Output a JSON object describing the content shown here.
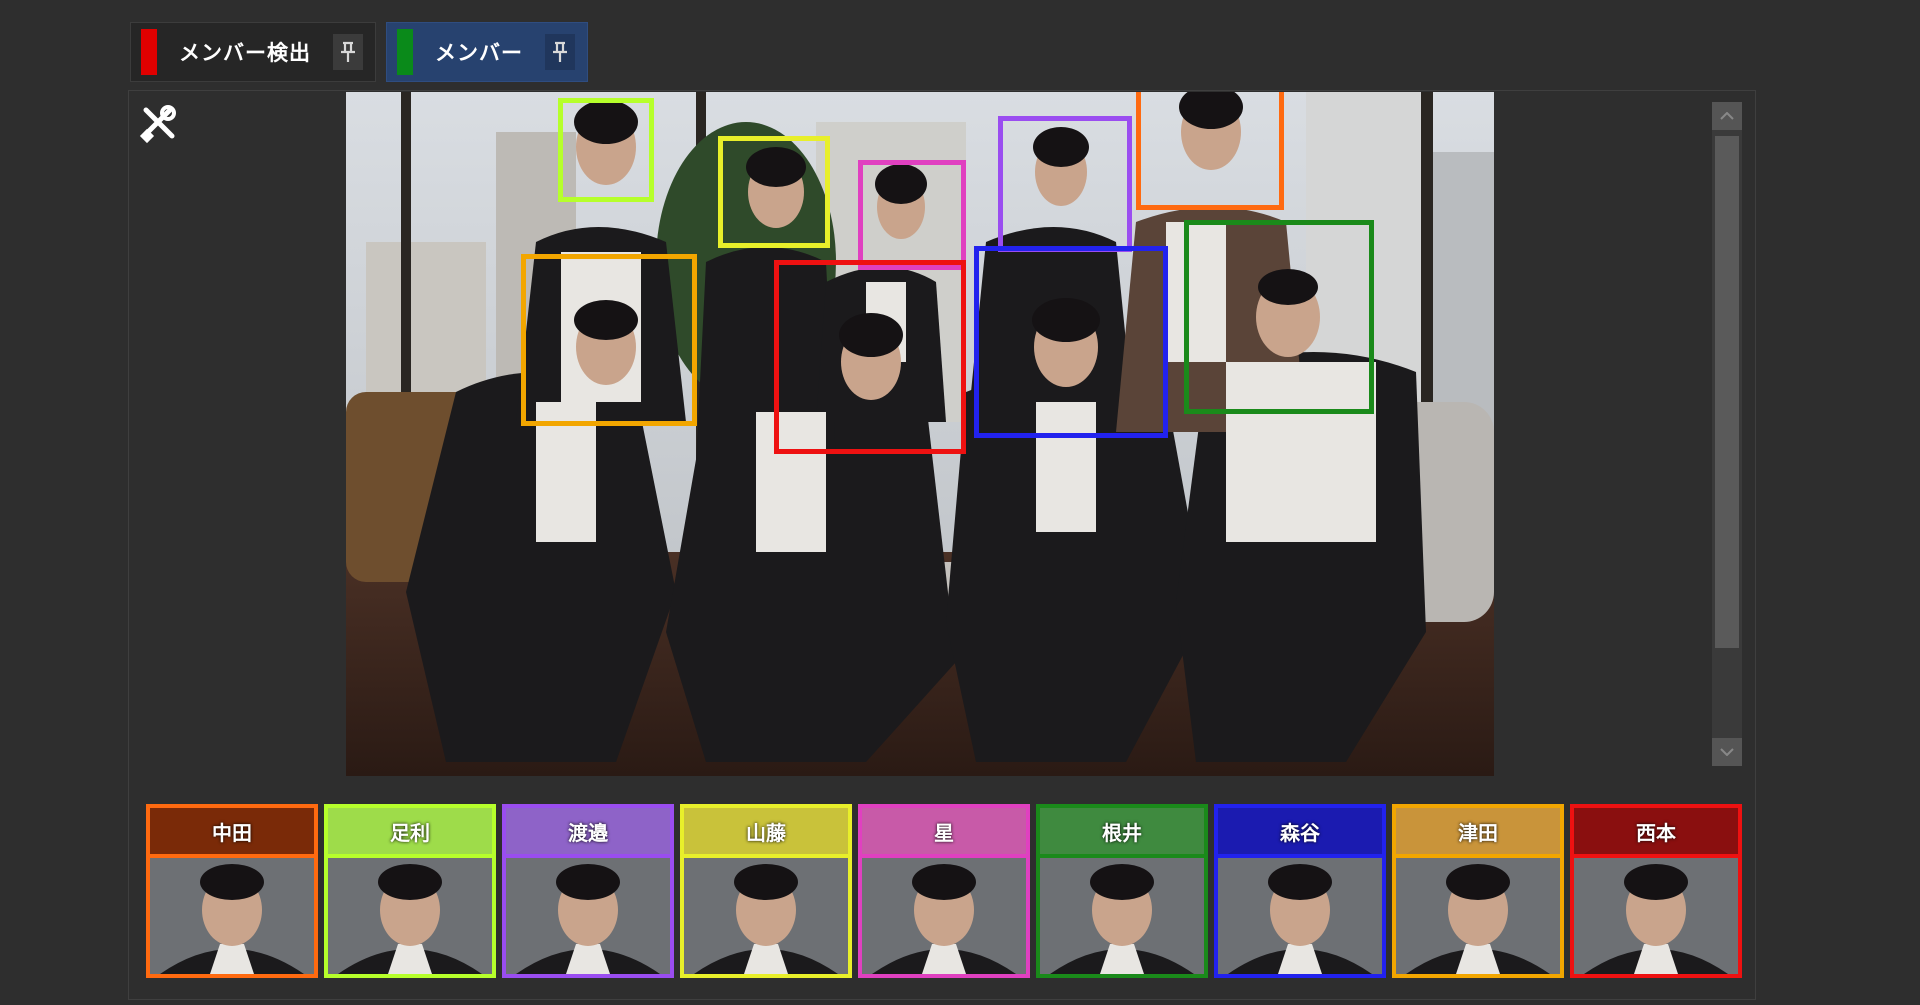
{
  "tabs": [
    {
      "label": "メンバー検出",
      "swatch": "#e00000",
      "active": false
    },
    {
      "label": "メンバー",
      "swatch": "#0a8a1a",
      "active": true
    }
  ],
  "tools": {
    "icon": "tools-icon"
  },
  "detections": [
    {
      "color": "#b6ff2b",
      "member": "足利"
    },
    {
      "color": "#e8ef2a",
      "member": "山藤"
    },
    {
      "color": "#e040c0",
      "member": "星"
    },
    {
      "color": "#9a4df0",
      "member": "渡邉"
    },
    {
      "color": "#ff6a10",
      "member": "中田"
    },
    {
      "color": "#f2a600",
      "member": "津田"
    },
    {
      "color": "#ee1111",
      "member": "西本"
    },
    {
      "color": "#2222ee",
      "member": "森谷"
    },
    {
      "color": "#1a8a1a",
      "member": "根井"
    }
  ],
  "members": [
    {
      "name": "中田",
      "color": "#ff6a10",
      "head": "#7a2a08"
    },
    {
      "name": "足利",
      "color": "#b6ff2b",
      "head": "#9edc4a"
    },
    {
      "name": "渡邉",
      "color": "#9a4df0",
      "head": "#8e63c8"
    },
    {
      "name": "山藤",
      "color": "#e8ef2a",
      "head": "#c9c23a"
    },
    {
      "name": "星",
      "color": "#e040c0",
      "head": "#c85aa8"
    },
    {
      "name": "根井",
      "color": "#1a8a1a",
      "head": "#3f8a3f"
    },
    {
      "name": "森谷",
      "color": "#2222ee",
      "head": "#1b1bb0"
    },
    {
      "name": "津田",
      "color": "#f2a600",
      "head": "#c9943a"
    },
    {
      "name": "西本",
      "color": "#ee1111",
      "head": "#8a0f0f"
    }
  ]
}
